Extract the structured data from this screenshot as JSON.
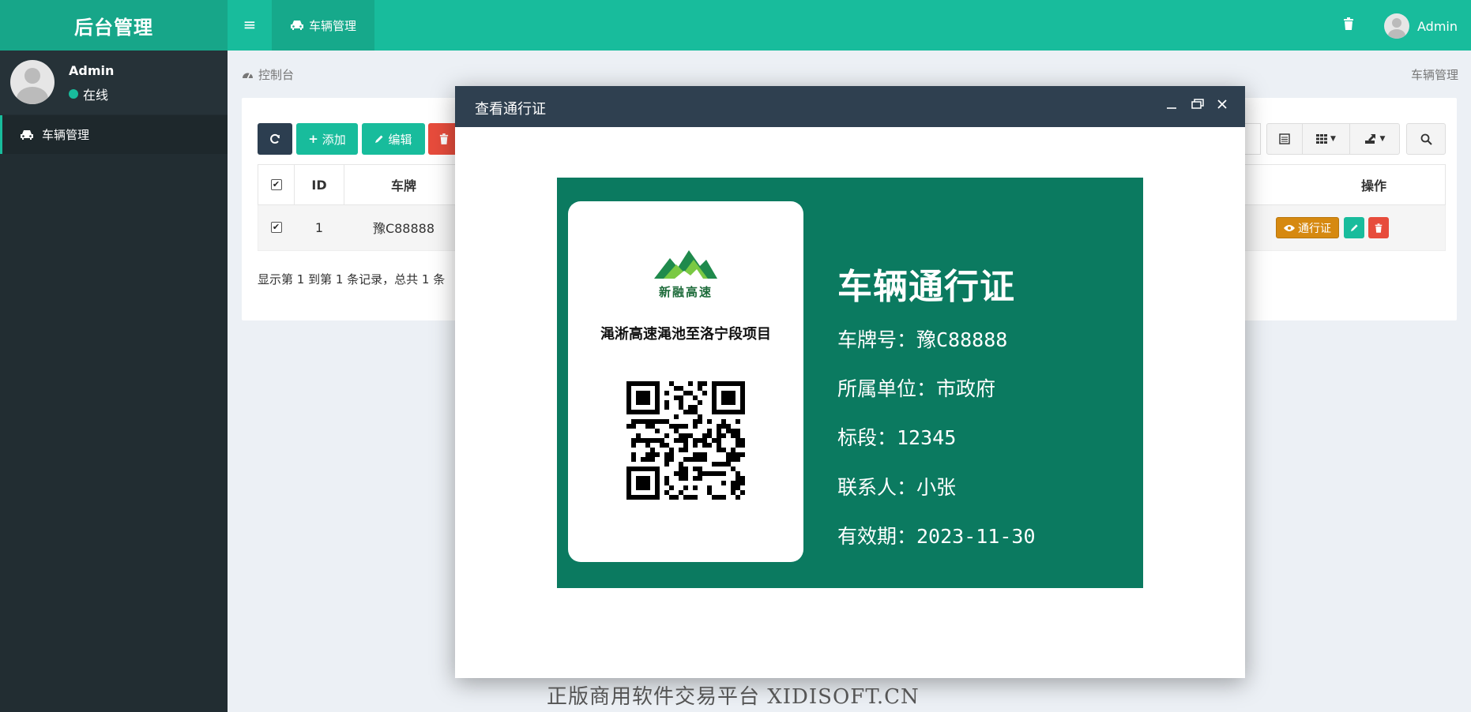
{
  "app": {
    "title": "后台管理",
    "user": "Admin"
  },
  "topbar": {
    "tab_label": "车辆管理"
  },
  "sidebar": {
    "user_name": "Admin",
    "status": "在线",
    "items": [
      {
        "label": "车辆管理"
      }
    ]
  },
  "breadcrumb": {
    "home": "控制台",
    "current": "车辆管理"
  },
  "toolbar": {
    "add_label": "添加",
    "edit_label": "编辑"
  },
  "table": {
    "columns": [
      "ID",
      "车牌",
      "操作"
    ],
    "rows": [
      {
        "id": "1",
        "plate": "豫C88888",
        "pass_label": "通行证"
      }
    ]
  },
  "pagination": {
    "summary": "显示第 1 到第 1 条记录，总共 1 条"
  },
  "modal": {
    "title": "查看通行证",
    "pass": {
      "logo_text": "新融高速",
      "project_name": "渑淅高速渑池至洛宁段项目",
      "heading": "车辆通行证",
      "plate_line": "车牌号：豫C88888",
      "unit_line": "所属单位：市政府",
      "section_line": "标段：12345",
      "contact_line": "联系人：小张",
      "valid_line": "有效期：2023-11-30"
    }
  },
  "watermark": "正版商用软件交易平台 XIDISOFT.CN",
  "colors": {
    "primary": "#18bc9c",
    "sidebar": "#222d32",
    "modal_header": "#2f4050",
    "pass_bg": "#0b7a60",
    "danger": "#e74c3c",
    "warning": "#d68910"
  }
}
